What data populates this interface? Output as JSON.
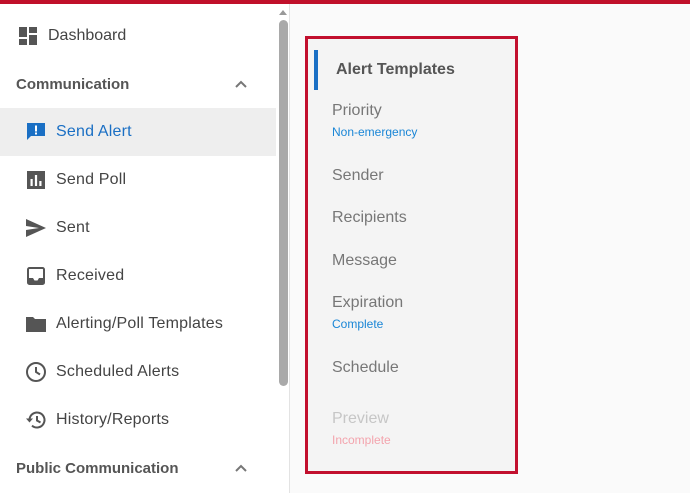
{
  "sidebar": {
    "dashboard": "Dashboard",
    "communication": {
      "heading": "Communication",
      "items": [
        {
          "label": "Send Alert",
          "icon": "alert-message-icon",
          "active": true
        },
        {
          "label": "Send Poll",
          "icon": "poll-chart-icon"
        },
        {
          "label": "Sent",
          "icon": "send-arrow-icon"
        },
        {
          "label": "Received",
          "icon": "inbox-icon"
        },
        {
          "label": "Alerting/Poll Templates",
          "icon": "folder-icon"
        },
        {
          "label": "Scheduled Alerts",
          "icon": "clock-icon"
        },
        {
          "label": "History/Reports",
          "icon": "history-icon"
        }
      ]
    },
    "public_communication": {
      "heading": "Public Communication"
    }
  },
  "steps": {
    "title": "Alert Templates",
    "items": [
      {
        "name": "Priority",
        "status": "Non-emergency"
      },
      {
        "name": "Sender",
        "status": ""
      },
      {
        "name": "Recipients",
        "status": ""
      },
      {
        "name": "Message",
        "status": ""
      },
      {
        "name": "Expiration",
        "status": "Complete"
      },
      {
        "name": "Schedule",
        "status": ""
      },
      {
        "name": "Preview",
        "status": "Incomplete"
      }
    ]
  },
  "colors": {
    "accent": "#1a6fc4",
    "highlight_border": "#c2102e",
    "link": "#1a86d6",
    "incomplete": "#f3a4ad"
  }
}
